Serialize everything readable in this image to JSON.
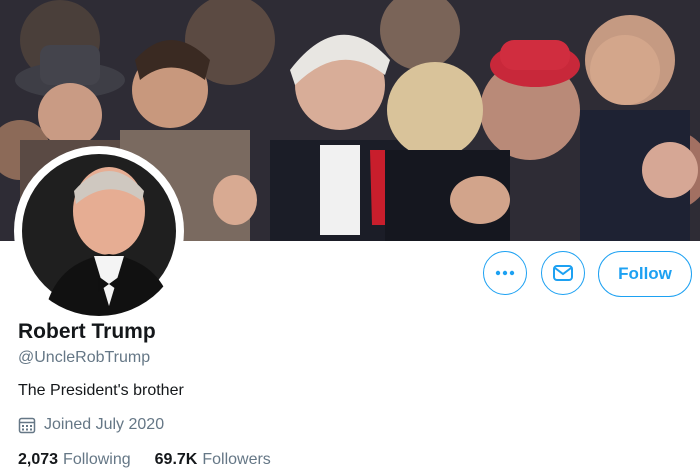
{
  "profile": {
    "name": "Robert Trump",
    "handle": "@UncleRobTrump",
    "bio": "The President's brother",
    "joined": "Joined July 2020",
    "following_count": "2,073",
    "following_label": "Following",
    "followers_count": "69.7K",
    "followers_label": "Followers"
  },
  "actions": {
    "more_icon": "more-horizontal-icon",
    "message_icon": "envelope-icon",
    "follow_label": "Follow"
  },
  "icons": {
    "joined": "calendar-icon"
  },
  "colors": {
    "accent": "#1da1f2",
    "text_primary": "#14171a",
    "text_secondary": "#657786"
  }
}
